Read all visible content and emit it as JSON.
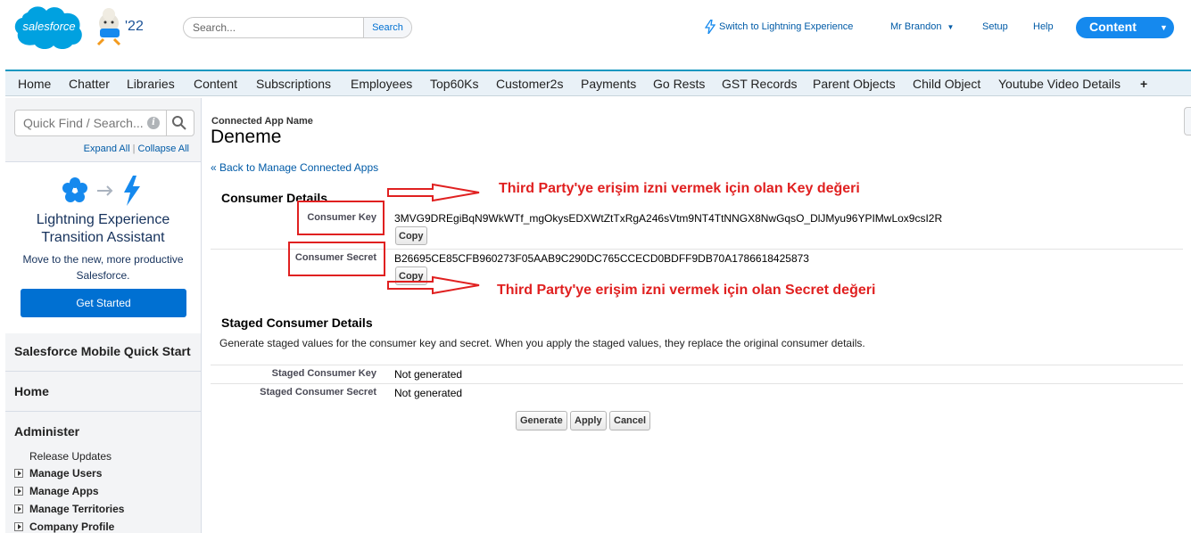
{
  "header": {
    "logo_text": "salesforce",
    "release_badge": "'22",
    "search": {
      "placeholder": "Search...",
      "button_label": "Search"
    },
    "links": {
      "switch_lightning": "Switch to Lightning Experience",
      "user_name": "Mr Brandon",
      "setup": "Setup",
      "help": "Help"
    },
    "app_menu_label": "Content"
  },
  "tabs": [
    "Home",
    "Chatter",
    "Libraries",
    "Content",
    "Subscriptions",
    "Employees",
    "Top60Ks",
    "Customer2s",
    "Payments",
    "Go Rests",
    "GST Records",
    "Parent Objects",
    "Child Object",
    "Youtube Video Details",
    "+"
  ],
  "sidebar": {
    "quick_find_placeholder": "Quick Find / Search...",
    "expand_all": "Expand All",
    "collapse_all": "Collapse All",
    "lightning_card": {
      "title_line1": "Lightning Experience",
      "title_line2": "Transition Assistant",
      "description": "Move to the new, more productive Salesforce.",
      "button_label": "Get Started"
    },
    "sections": [
      "Salesforce Mobile Quick Start",
      "Home",
      "Administer"
    ],
    "administer_items": [
      "Release Updates"
    ],
    "tree_items": [
      "Manage Users",
      "Manage Apps",
      "Manage Territories",
      "Company Profile"
    ]
  },
  "page": {
    "type_label": "Connected App Name",
    "title": "Deneme",
    "back_link": "« Back to Manage Connected Apps",
    "consumer_details": {
      "heading": "Consumer Details",
      "key_label": "Consumer Key",
      "key_value": "3MVG9DREgiBqN9WkWTf_mgOkysEDXWtZtTxRgA246sVtm9NT4TtNNGX8NwGqsO_DlJMyu96YPIMwLox9csI2R",
      "secret_label": "Consumer Secret",
      "secret_value": "B26695CE85CFB960273F05AAB9C290DC765CCECD0BDFF9DB70A1786618425873",
      "copy_label": "Copy"
    },
    "staged_details": {
      "heading": "Staged Consumer Details",
      "description": "Generate staged values for the consumer key and secret. When you apply the staged values, they replace the original consumer details.",
      "key_label": "Staged Consumer Key",
      "key_value": "Not generated",
      "secret_label": "Staged Consumer Secret",
      "secret_value": "Not generated"
    },
    "buttons": {
      "generate": "Generate",
      "apply": "Apply",
      "cancel": "Cancel"
    }
  },
  "annotations": {
    "key_note": "Third Party'ye erişim izni vermek için olan Key değeri",
    "secret_note": "Third Party'ye erişim izni vermek için olan Secret değeri",
    "color": "#e02020"
  },
  "colors": {
    "brand_blue": "#00a1e0",
    "link": "#015ba7",
    "tab_border": "#1797c0",
    "button_blue": "#0070d2"
  }
}
